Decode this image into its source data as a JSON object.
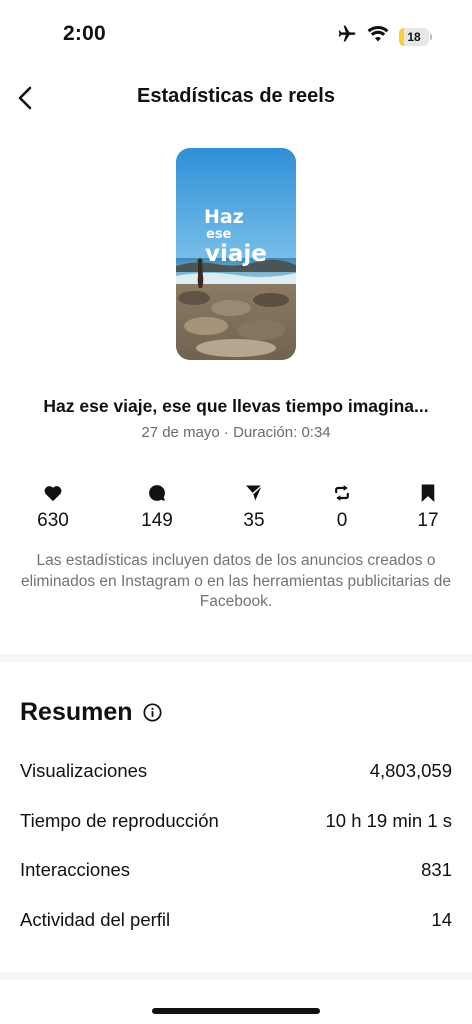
{
  "status_bar": {
    "time": "2:00",
    "battery_level": "18",
    "battery_color": "#f6d234",
    "icons": [
      "airplane-icon",
      "wifi-icon",
      "battery-icon"
    ]
  },
  "nav": {
    "title": "Estadísticas de reels",
    "back_icon": "chevron-left-icon"
  },
  "reel": {
    "thumbnail_text": [
      "Haz",
      "ese",
      "viaje"
    ],
    "caption": "Haz ese viaje, ese que llevas tiempo imagina...",
    "meta": "27 de mayo · Duración: 0:34"
  },
  "stats": [
    {
      "icon": "heart-icon",
      "value": "630"
    },
    {
      "icon": "comment-icon",
      "value": "149"
    },
    {
      "icon": "share-icon",
      "value": "35"
    },
    {
      "icon": "repost-icon",
      "value": "0"
    },
    {
      "icon": "bookmark-icon",
      "value": "17"
    }
  ],
  "disclaimer": "Las estadísticas incluyen datos de los anuncios creados o eliminados en Instagram o en las herramientas publicitarias de Facebook.",
  "summary": {
    "title": "Resumen",
    "info_icon": "info-icon",
    "rows": [
      {
        "label": "Visualizaciones",
        "value": "4,803,059"
      },
      {
        "label": "Tiempo de reproducción",
        "value": "10 h 19 min 1 s"
      },
      {
        "label": "Interacciones",
        "value": "831"
      },
      {
        "label": "Actividad del perfil",
        "value": "14"
      }
    ]
  }
}
